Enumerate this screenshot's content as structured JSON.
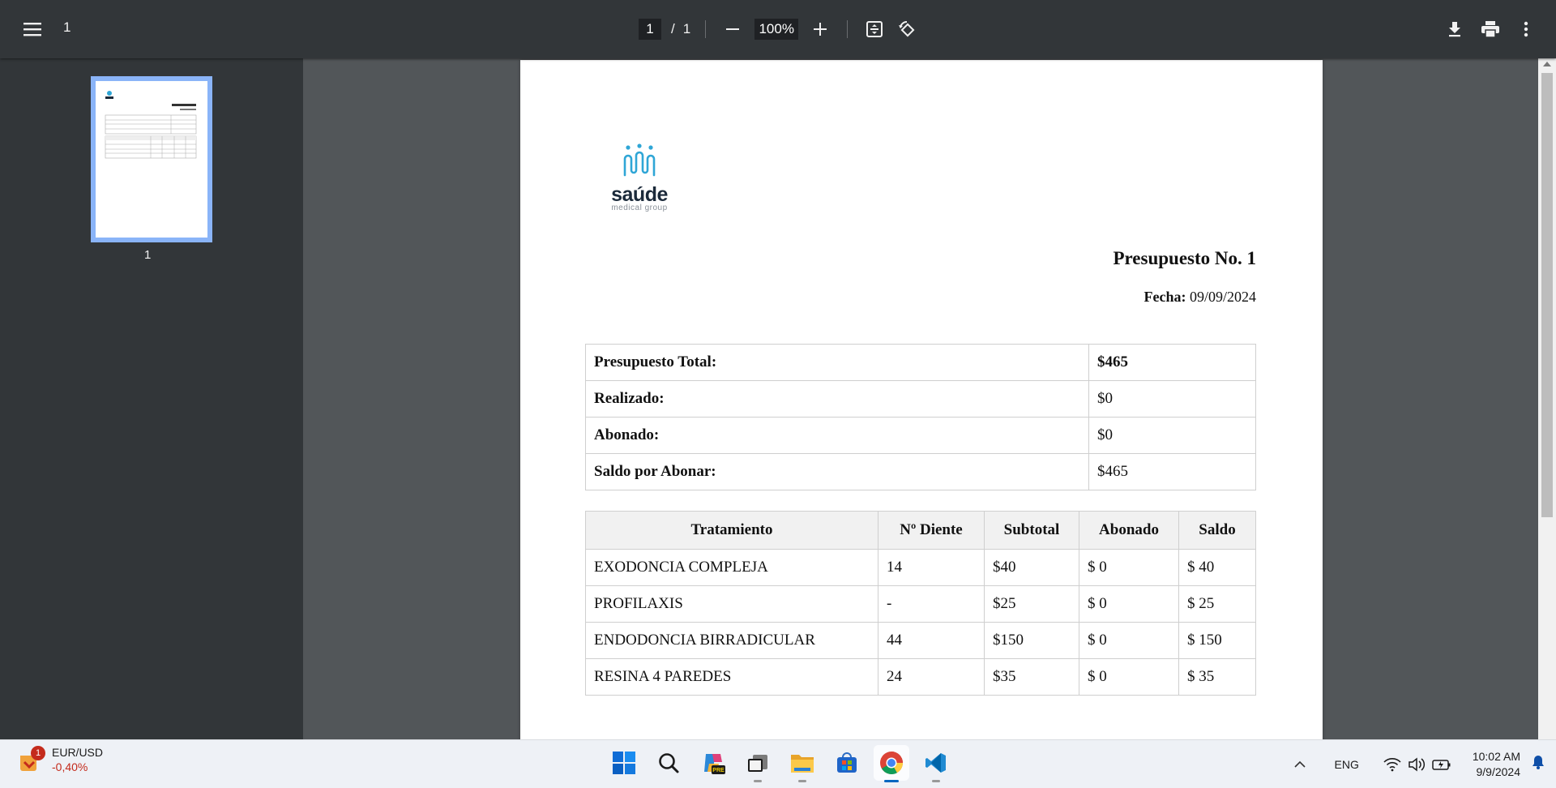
{
  "toolbar": {
    "title": "1",
    "page_current": "1",
    "page_separator": "/",
    "page_total": "1",
    "zoom": "100%"
  },
  "sidebar": {
    "thumbnail_label": "1"
  },
  "document": {
    "logo_word": "saúde",
    "logo_sub": "medical group",
    "title": "Presupuesto No. 1",
    "date_label": "Fecha:",
    "date_value": "09/09/2024",
    "summary": [
      {
        "label": "Presupuesto Total:",
        "value": "$465"
      },
      {
        "label": "Realizado:",
        "value": "$0"
      },
      {
        "label": "Abonado:",
        "value": "$0"
      },
      {
        "label": "Saldo por Abonar:",
        "value": "$465"
      }
    ],
    "treatments": {
      "headers": [
        "Tratamiento",
        "Nº Diente",
        "Subtotal",
        "Abonado",
        "Saldo"
      ],
      "rows": [
        [
          "EXODONCIA COMPLEJA",
          "14",
          "$40",
          "$ 0",
          "$ 40"
        ],
        [
          "PROFILAXIS",
          "-",
          "$25",
          "$ 0",
          "$ 25"
        ],
        [
          "ENDODONCIA BIRRADICULAR",
          "44",
          "$150",
          "$ 0",
          "$ 150"
        ],
        [
          "RESINA 4 PAREDES",
          "24",
          "$35",
          "$ 0",
          "$ 35"
        ]
      ]
    }
  },
  "taskbar": {
    "widget_badge": "1",
    "widget_title": "EUR/USD",
    "widget_change": "-0,40%",
    "apps": [
      "windows-start-icon",
      "search-icon",
      "copilot-icon",
      "task-view-icon",
      "file-explorer-icon",
      "microsoft-store-icon",
      "chrome-icon",
      "vscode-icon"
    ],
    "tray_lang": "ENG",
    "time": "10:02 AM",
    "date": "9/9/2024"
  },
  "colors": {
    "toolbar_bg": "#323639",
    "viewer_bg": "#525659",
    "thumb_border": "#8ab4f8",
    "logo_blue": "#2fa6d6",
    "accent": "#0067c0"
  }
}
